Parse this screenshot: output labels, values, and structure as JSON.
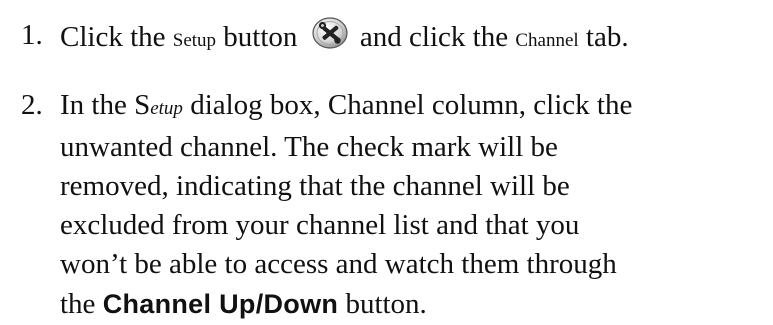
{
  "step1": {
    "number": "1.",
    "text_before": "Click the ",
    "setup_word": "Setup",
    "text_button": " button ",
    "text_after": " and click the ",
    "channel_word": "Channel",
    "text_end": " tab."
  },
  "step2": {
    "number": "2.",
    "line1_a": "In the S",
    "line1_italic": "etup",
    "line1_b": " dialog box, Channel column, click the",
    "line2": "unwanted channel. The check mark will be",
    "line3": "removed, indicating that the channel will be",
    "line4": "excluded from your channel list and that you",
    "line5": "won’t be able to access and watch them through",
    "line6_a": "the ",
    "line6_bold": "Channel Up/Down",
    "line6_b": " button."
  },
  "icons": {
    "setup_button": "setup-tools-icon"
  }
}
